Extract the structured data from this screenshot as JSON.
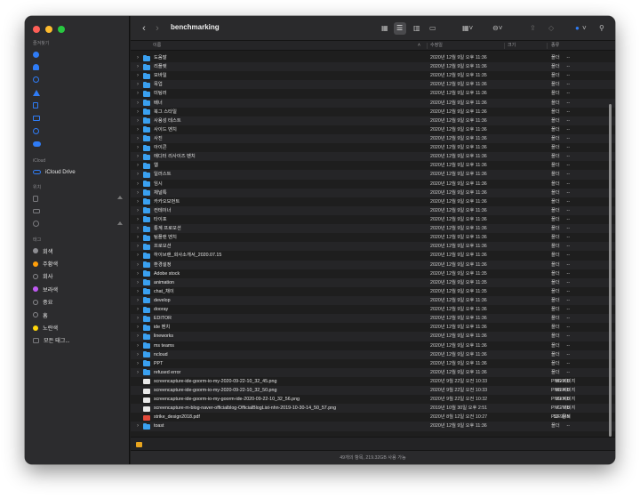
{
  "window": {
    "title": "benchmarking"
  },
  "sidebar": {
    "favorites_header": "즐겨찾기",
    "favorites": [
      {
        "icon": "airdrop-icon"
      },
      {
        "icon": "applications-icon"
      },
      {
        "icon": "recents-icon"
      },
      {
        "icon": "apps-icon"
      },
      {
        "icon": "documents-icon"
      },
      {
        "icon": "desktop-icon"
      },
      {
        "icon": "downloads-icon"
      },
      {
        "icon": "creative-cloud-icon"
      }
    ],
    "icloud_header": "iCloud",
    "icloud_drive": "iCloud Drive",
    "locations_header": "위치",
    "locations": [
      {
        "icon": "file-icon"
      },
      {
        "icon": "drive-icon"
      },
      {
        "icon": "clock-icon"
      }
    ],
    "tags_header": "태그",
    "tags": [
      {
        "label": "회색",
        "color": "#8e8e93"
      },
      {
        "label": "주황색",
        "color": "#ff9f0a"
      },
      {
        "label": "회사",
        "color": "outline"
      },
      {
        "label": "보라색",
        "color": "#bf5af2"
      },
      {
        "label": "중요",
        "color": "outline"
      },
      {
        "label": "홈",
        "color": "outline"
      },
      {
        "label": "노란색",
        "color": "#ffd60a"
      },
      {
        "label": "모든 태그...",
        "color": "all"
      }
    ]
  },
  "toolbar": {
    "back": "‹",
    "forward": "›",
    "view_icons": [
      "grid-view-icon",
      "list-view-icon",
      "column-view-icon",
      "gallery-view-icon",
      "group-icon",
      "action-icon",
      "share-icon",
      "tag-icon",
      "more-icon",
      "search-icon"
    ]
  },
  "columns": {
    "name": "이름",
    "date": "수정일",
    "size": "크기",
    "kind": "종류"
  },
  "files": [
    {
      "name": "도움말",
      "date": "2020년 12월 9일 오후 11:36",
      "size": "--",
      "kind": "폴더",
      "type": "folder"
    },
    {
      "name": "리플렛",
      "date": "2020년 12월 9일 오후 11:36",
      "size": "--",
      "kind": "폴더",
      "type": "folder"
    },
    {
      "name": "모바일",
      "date": "2020년 12월 9일 오후 11:35",
      "size": "--",
      "kind": "폴더",
      "type": "folder"
    },
    {
      "name": "목업",
      "date": "2020년 12월 9일 오후 11:36",
      "size": "--",
      "kind": "폴더",
      "type": "folder"
    },
    {
      "name": "미팅러",
      "date": "2020년 12월 9일 오후 11:36",
      "size": "--",
      "kind": "폴더",
      "type": "folder"
    },
    {
      "name": "배너",
      "date": "2020년 12월 9일 오후 11:36",
      "size": "--",
      "kind": "폴더",
      "type": "folder"
    },
    {
      "name": "북그 스타일",
      "date": "2020년 12월 9일 오후 11:36",
      "size": "--",
      "kind": "폴더",
      "type": "folder"
    },
    {
      "name": "사용성 테스트",
      "date": "2020년 12월 9일 오후 11:36",
      "size": "--",
      "kind": "폴더",
      "type": "folder"
    },
    {
      "name": "사이드 벤치",
      "date": "2020년 12월 9일 오후 11:36",
      "size": "--",
      "kind": "폴더",
      "type": "folder"
    },
    {
      "name": "사진",
      "date": "2020년 12월 9일 오후 11:36",
      "size": "--",
      "kind": "폴더",
      "type": "folder"
    },
    {
      "name": "아이콘",
      "date": "2020년 12월 9일 오후 11:36",
      "size": "--",
      "kind": "폴더",
      "type": "folder"
    },
    {
      "name": "에디터 리사이즈 벤치",
      "date": "2020년 12월 9일 오후 11:36",
      "size": "--",
      "kind": "폴더",
      "type": "folder"
    },
    {
      "name": "웹",
      "date": "2020년 12월 9일 오후 11:36",
      "size": "--",
      "kind": "폴더",
      "type": "folder"
    },
    {
      "name": "일러스트",
      "date": "2020년 12월 9일 오후 11:36",
      "size": "--",
      "kind": "폴더",
      "type": "folder"
    },
    {
      "name": "임시",
      "date": "2020년 12월 9일 오후 11:36",
      "size": "--",
      "kind": "폴더",
      "type": "folder"
    },
    {
      "name": "채널톡",
      "date": "2020년 12월 9일 오후 11:36",
      "size": "--",
      "kind": "폴더",
      "type": "folder"
    },
    {
      "name": "카카오모먼트",
      "date": "2020년 12월 9일 오후 11:36",
      "size": "--",
      "kind": "폴더",
      "type": "folder"
    },
    {
      "name": "컨테이너",
      "date": "2020년 12월 9일 오후 11:36",
      "size": "--",
      "kind": "폴더",
      "type": "folder"
    },
    {
      "name": "타이포",
      "date": "2020년 12월 9일 오후 11:36",
      "size": "--",
      "kind": "폴더",
      "type": "folder"
    },
    {
      "name": "통계 프로모션",
      "date": "2020년 12월 9일 오후 11:36",
      "size": "--",
      "kind": "폴더",
      "type": "folder"
    },
    {
      "name": "팀플랜 벤치",
      "date": "2020년 12월 9일 오후 11:36",
      "size": "--",
      "kind": "폴더",
      "type": "folder"
    },
    {
      "name": "프로모션",
      "date": "2020년 12월 9일 오후 11:36",
      "size": "--",
      "kind": "폴더",
      "type": "folder"
    },
    {
      "name": "하이브랜_회사소개서_2020.07.15",
      "date": "2020년 12월 9일 오후 11:36",
      "size": "--",
      "kind": "폴더",
      "type": "folder"
    },
    {
      "name": "환경설정",
      "date": "2020년 12월 9일 오후 11:36",
      "size": "--",
      "kind": "폴더",
      "type": "folder"
    },
    {
      "name": "Adobe stock",
      "date": "2020년 12월 9일 오후 11:35",
      "size": "--",
      "kind": "폴더",
      "type": "folder"
    },
    {
      "name": "animation",
      "date": "2020년 12월 9일 오후 11:35",
      "size": "--",
      "kind": "폴더",
      "type": "folder"
    },
    {
      "name": "chat_채이",
      "date": "2020년 12월 9일 오후 11:35",
      "size": "--",
      "kind": "폴더",
      "type": "folder"
    },
    {
      "name": "develop",
      "date": "2020년 12월 9일 오후 11:36",
      "size": "--",
      "kind": "폴더",
      "type": "folder"
    },
    {
      "name": "dooray",
      "date": "2020년 12월 9일 오후 11:36",
      "size": "--",
      "kind": "폴더",
      "type": "folder"
    },
    {
      "name": "EDITOR",
      "date": "2020년 12월 9일 오후 11:36",
      "size": "--",
      "kind": "폴더",
      "type": "folder"
    },
    {
      "name": "ide 벤치",
      "date": "2020년 12월 9일 오후 11:36",
      "size": "--",
      "kind": "폴더",
      "type": "folder"
    },
    {
      "name": "lineworks",
      "date": "2020년 12월 9일 오후 11:36",
      "size": "--",
      "kind": "폴더",
      "type": "folder"
    },
    {
      "name": "ms teams",
      "date": "2020년 12월 9일 오후 11:36",
      "size": "--",
      "kind": "폴더",
      "type": "folder"
    },
    {
      "name": "ncloud",
      "date": "2020년 12월 9일 오후 11:36",
      "size": "--",
      "kind": "폴더",
      "type": "folder"
    },
    {
      "name": "PPT",
      "date": "2020년 12월 9일 오후 11:36",
      "size": "--",
      "kind": "폴더",
      "type": "folder"
    },
    {
      "name": "refused error",
      "date": "2020년 12월 9일 오후 11:36",
      "size": "--",
      "kind": "폴더",
      "type": "folder"
    },
    {
      "name": "screencapture-ide-goorm-io-my-2020-09-22-10_32_45.png",
      "date": "2020년 9월 22일 오전 10:33",
      "size": "866KB",
      "kind": "PNG 이미지",
      "type": "image"
    },
    {
      "name": "screencapture-ide-goorm-io-my-2020-09-22-10_32_50.png",
      "date": "2020년 9월 22일 오전 10:33",
      "size": "889KB",
      "kind": "PNG 이미지",
      "type": "image"
    },
    {
      "name": "screencapture-ide-goorm-io-my-goorm-ide-2020-09-22-10_32_56.png",
      "date": "2020년 9월 22일 오전 10:32",
      "size": "390KB",
      "kind": "PNG 이미지",
      "type": "image"
    },
    {
      "name": "screencapture-m-blog-naver-officialblog-OfficialBlogList-nhn-2019-10-30-14_50_57.png",
      "date": "2019년 10월 30일 오후 2:51",
      "size": "7.7MB",
      "kind": "PNG 이미지",
      "type": "image"
    },
    {
      "name": "strike_design2018.pdf",
      "date": "2020년 8월 12일 오전 10:27",
      "size": "52.9MB",
      "kind": "PDF 문서",
      "type": "pdf"
    },
    {
      "name": "toast",
      "date": "2020년 12월 9일 오후 11:36",
      "size": "--",
      "kind": "폴더",
      "type": "folder"
    }
  ],
  "status": "49개의 항목, 219.32GB 사용 가능"
}
